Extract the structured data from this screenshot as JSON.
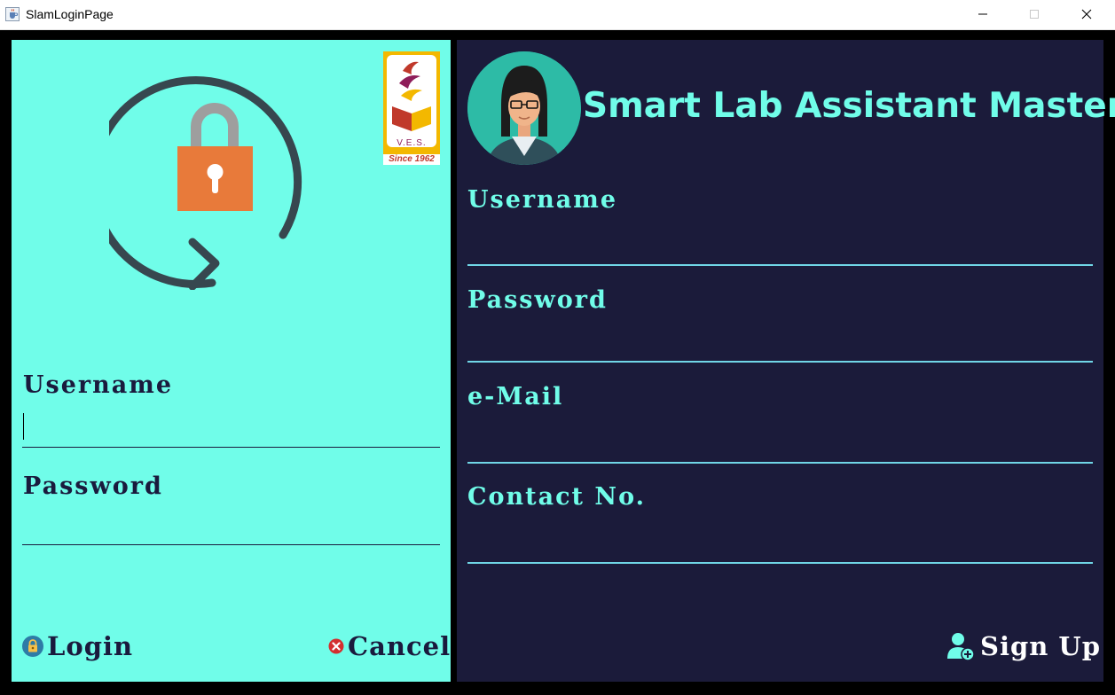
{
  "window": {
    "title": "SlamLoginPage",
    "icon": "java-cup-icon"
  },
  "colors": {
    "left_panel_bg": "#70fde9",
    "right_panel_bg": "#1b1b3a",
    "accent": "#70fde9",
    "dark_text": "#1a1a3d",
    "lock_orange": "#e87a3a",
    "arrow_gray": "#37474f"
  },
  "logo": {
    "text_abbrev": "V.E.S.",
    "text_since": "Since 1962"
  },
  "login_panel": {
    "username_label": "Username",
    "username_value": "",
    "password_label": "Password",
    "password_value": "",
    "login_label": "Login",
    "login_icon": "lock-icon",
    "cancel_label": "Cancel",
    "cancel_icon": "cancel-x-icon"
  },
  "signup_panel": {
    "title": "Smart Lab Assistant Master",
    "avatar_icon": "woman-avatar-icon",
    "username_label": "Username",
    "password_label": "Password",
    "email_label": "e-Mail",
    "contact_label": "Contact No.",
    "signup_label": "Sign Up",
    "signup_icon": "add-user-icon"
  }
}
